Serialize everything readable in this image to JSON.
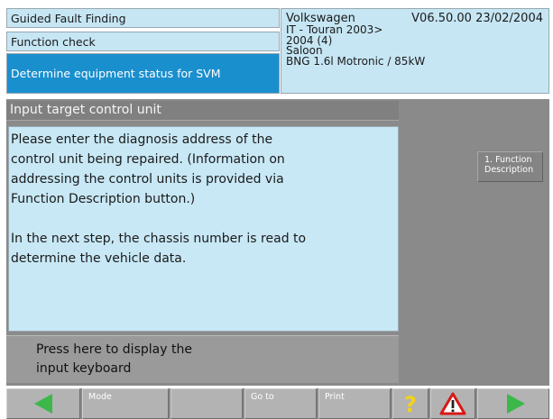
{
  "header": {
    "title": "Guided Fault Finding",
    "function": "Function check",
    "task": "Determine equipment status for SVM",
    "vehicle": {
      "make": "Volkswagen",
      "version": "V06.50.00 23/02/2004",
      "model": "IT - Touran 2003>",
      "year": "2004 (4)",
      "body": "Saloon",
      "engine": "BNG 1.6l Motronic / 85kW"
    }
  },
  "main": {
    "section_title": "Input target control unit",
    "paragraph1_lines": [
      "Please enter the diagnosis address of the",
      "control unit being repaired. (Information on",
      "addressing the control units is provided via",
      "Function Description button.)"
    ],
    "paragraph2_lines": [
      "In the next step, the chassis number is read to",
      "determine the vehicle data."
    ],
    "side_button": [
      "1. Function",
      "Description"
    ],
    "keyboard_button": [
      "Press here to display the",
      "input keyboard"
    ]
  },
  "toolbar": {
    "mode": "Mode",
    "goto": "Go to",
    "print": "Print",
    "help_icon": "question-mark-icon",
    "warning_icon": "warning-triangle-icon",
    "back_icon": "arrow-left-icon",
    "forward_icon": "arrow-right-icon"
  },
  "colors": {
    "header_bg": "#c6e6f4",
    "selected_bg": "#1a8fce",
    "panel_gray": "#8a8a8a",
    "arrow_green": "#3cb84a",
    "help_yellow": "#f2d21e",
    "warning_red": "#d81818"
  }
}
